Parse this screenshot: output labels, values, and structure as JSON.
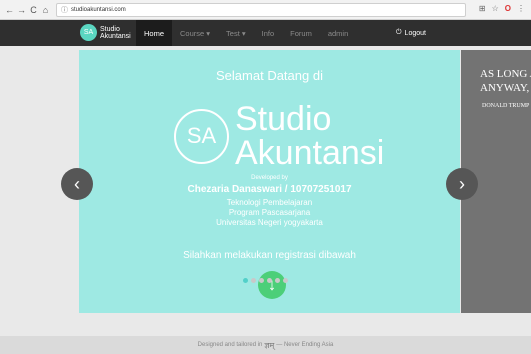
{
  "browser": {
    "url": "studioakuntansi.com",
    "nav_icons": [
      "arrow-left-icon",
      "arrow-right-icon",
      "reload-icon",
      "home-icon"
    ]
  },
  "navbar": {
    "brand_logo": "SA",
    "brand_name_1": "Studio",
    "brand_name_2": "Akuntansi",
    "items": [
      {
        "label": "Home"
      },
      {
        "label": "Course ▾"
      },
      {
        "label": "Test ▾"
      },
      {
        "label": "Info"
      },
      {
        "label": "Forum"
      },
      {
        "label": "admin"
      }
    ],
    "logout": "Logout"
  },
  "slide": {
    "welcome": "Selamat Datang di",
    "logo_mark": "SA",
    "logo_text_1": "Studio",
    "logo_text_2": "Akuntansi",
    "developed_by": "Developed by",
    "developer": "Chezaria Danaswari / 10707251017",
    "lines": [
      "Teknologi Pembelajaran",
      "Program Pascasarjana",
      "Universitas Negeri yogyakarta"
    ],
    "register": "Silahkan melakukan registrasi dibawah",
    "down_icon": "arrow-down-icon"
  },
  "next_slide": {
    "quote_1": "AS LONG A",
    "quote_2": "ANYWAY, T",
    "author": "DONALD TRUMP"
  },
  "carousel": {
    "prev_icon": "chevron-left-icon",
    "next_icon": "chevron-right-icon",
    "dot_count": 6,
    "active_dot": 0
  },
  "footer": {
    "text_before": "Designed and tailored in",
    "mark": "ज्ञम्",
    "text_after": "— Never Ending Asia"
  }
}
